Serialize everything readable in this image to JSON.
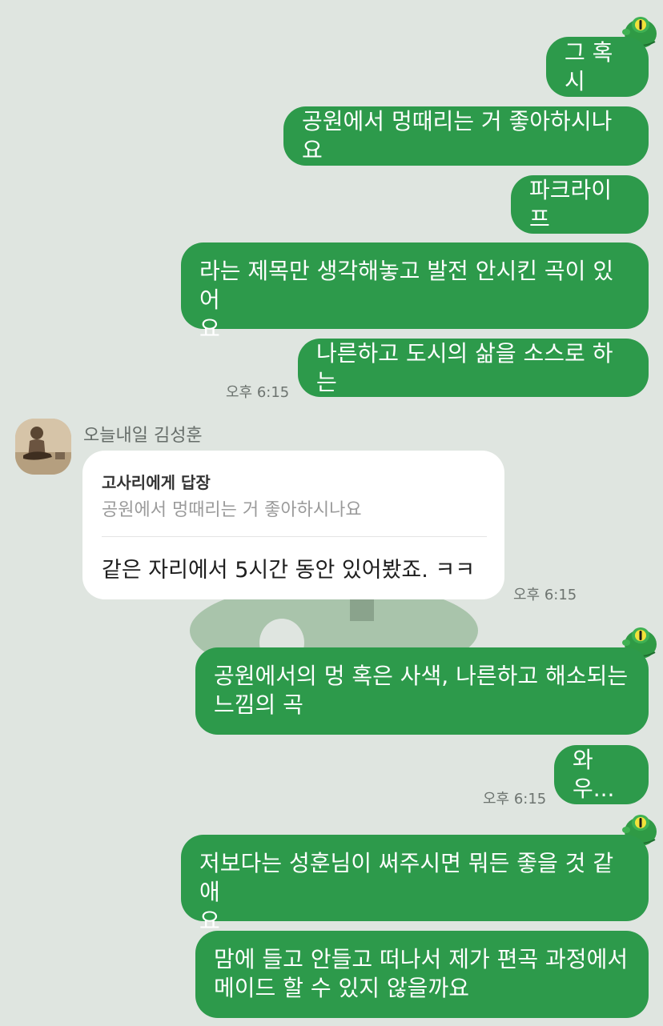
{
  "colors": {
    "background": "#dfe5e0",
    "sent_bubble": "#2d9a4b",
    "received_bubble": "#ffffff",
    "timestamp": "#6d7470"
  },
  "messages": {
    "m1": "그 혹시",
    "m2": "공원에서 멍때리는 거 좋아하시나요",
    "m3": "파크라이프",
    "m4_line1": "라는 제목만 생각해놓고 발전 안시킨 곡이 있어",
    "m4_line2": "요",
    "m5": "나른하고 도시의 삶을 소스로 하는",
    "m5_time": "오후 6:15"
  },
  "received": {
    "sender_name": "오늘내일 김성훈",
    "reply_title": "고사리에게 답장",
    "reply_quote": "공원에서 멍때리는 거 좋아하시나요",
    "text": "같은 자리에서 5시간 동안 있어봤죠. ㅋㅋ",
    "time": "오후 6:15"
  },
  "messages2": {
    "m6_line1": "공원에서의 멍 혹은 사색, 나른하고 해소되는",
    "m6_line2": "느낌의 곡",
    "m7": "와우...",
    "m7_time": "오후 6:15",
    "m8_line1": "저보다는 성훈님이 써주시면 뭐든 좋을 것 같애",
    "m8_line2": "요",
    "m9_line1": "맘에 들고 안들고 떠나서 제가 편곡 과정에서",
    "m9_line2": "메이드 할 수 있지 않을까요"
  },
  "icons": {
    "frog": "green-frog-profile-icon",
    "avatar": "guitarist-avatar"
  }
}
